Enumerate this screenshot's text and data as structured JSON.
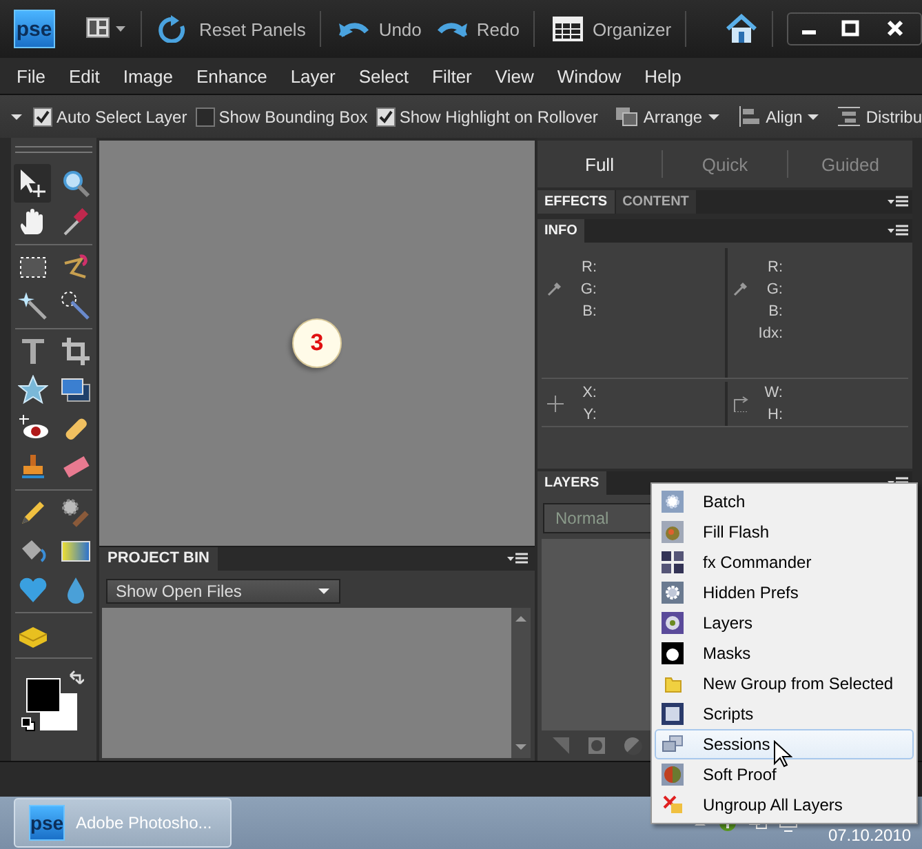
{
  "app_bar": {
    "logo": "pse",
    "buttons": [
      {
        "kind": "reset",
        "label": "Reset Panels"
      },
      {
        "kind": "undo",
        "label": "Undo"
      },
      {
        "kind": "redo",
        "label": "Redo"
      },
      {
        "kind": "organizer",
        "label": "Organizer"
      }
    ]
  },
  "menu_bar": [
    "File",
    "Edit",
    "Image",
    "Enhance",
    "Layer",
    "Select",
    "Filter",
    "View",
    "Window",
    "Help"
  ],
  "options_bar": {
    "checkboxes": [
      {
        "label": "Auto Select Layer",
        "checked": true
      },
      {
        "label": "Show Bounding Box",
        "checked": false
      },
      {
        "label": "Show Highlight on Rollover",
        "checked": true
      }
    ],
    "dropdowns": [
      {
        "kind": "arrange",
        "label": "Arrange"
      },
      {
        "kind": "align",
        "label": "Align"
      },
      {
        "kind": "distribute",
        "label": "Distribu"
      }
    ]
  },
  "tools": [
    {
      "selected": true
    },
    {
      "selected": false
    },
    {
      "selected": false
    },
    {
      "selected": false
    },
    {
      "selected": false
    },
    {
      "selected": false
    },
    {
      "selected": false
    },
    {
      "selected": false
    },
    {
      "selected": false
    },
    {
      "selected": false
    },
    {
      "selected": false
    },
    {
      "selected": false
    },
    {
      "selected": false
    },
    {
      "selected": false
    },
    {
      "selected": false
    },
    {
      "selected": false
    },
    {
      "selected": false
    },
    {
      "selected": false
    },
    {
      "selected": false
    },
    {
      "selected": false
    },
    {
      "selected": false
    },
    {
      "selected": false
    },
    {
      "selected": false
    }
  ],
  "canvas": {
    "badge": "3"
  },
  "project_bin": {
    "title": "PROJECT BIN",
    "dropdown": "Show Open Files"
  },
  "mode_tabs": [
    {
      "label": "Full",
      "selected": true
    },
    {
      "label": "Quick",
      "selected": false
    },
    {
      "label": "Guided",
      "selected": false
    }
  ],
  "effects_panel": {
    "tabs": [
      {
        "label": "EFFECTS",
        "selected": true
      },
      {
        "label": "CONTENT",
        "selected": false
      }
    ]
  },
  "info_panel": {
    "title": "INFO",
    "color_left": [
      "R:",
      "G:",
      "B:"
    ],
    "color_right": [
      "R:",
      "G:",
      "B:",
      "Idx:"
    ],
    "position": [
      "X:",
      "Y:"
    ],
    "size": [
      "W:",
      "H:"
    ]
  },
  "layers_panel": {
    "title": "LAYERS",
    "blend_mode": "Normal"
  },
  "context_menu": [
    {
      "label": "Batch",
      "selected": false
    },
    {
      "label": "Fill Flash",
      "selected": false
    },
    {
      "label": "fx Commander",
      "selected": false
    },
    {
      "label": "Hidden Prefs",
      "selected": false
    },
    {
      "label": "Layers",
      "selected": false
    },
    {
      "label": "Masks",
      "selected": false
    },
    {
      "label": "New Group from Selected",
      "selected": false
    },
    {
      "label": "Scripts",
      "selected": false
    },
    {
      "label": "Sessions",
      "selected": true
    },
    {
      "label": "Soft Proof",
      "selected": false
    },
    {
      "label": "Ungroup All Layers",
      "selected": false
    }
  ],
  "taskbar": {
    "logo": "pse",
    "task": "Adobe Photosho...",
    "clock": "07.10.2010"
  }
}
